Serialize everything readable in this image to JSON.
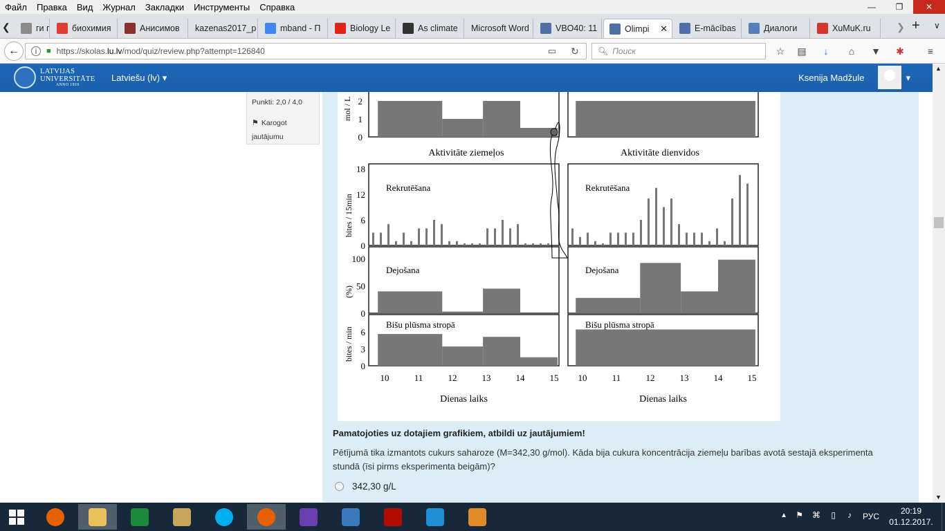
{
  "menubar": {
    "items": [
      "Файл",
      "Правка",
      "Вид",
      "Журнал",
      "Закладки",
      "Инструменты",
      "Справка"
    ]
  },
  "tabs": [
    {
      "label": "ги по Э",
      "icon": "doc-icon",
      "color": "#8a8a8a"
    },
    {
      "label": "биохимия",
      "icon": "yandex-icon",
      "color": "#e03c31"
    },
    {
      "label": "Анисимов",
      "icon": "chart-icon",
      "color": "#8b2f2f"
    },
    {
      "label": "kazenas2017_p",
      "icon": "blank-icon",
      "color": "#ffffff"
    },
    {
      "label": "mband - П",
      "icon": "google-icon",
      "color": "#4285f4"
    },
    {
      "label": "Biology Le",
      "icon": "youtube-icon",
      "color": "#e62117"
    },
    {
      "label": "As climate",
      "icon": "sd-icon",
      "color": "#333333"
    },
    {
      "label": "Microsoft Word",
      "icon": "blank-icon",
      "color": "#ffffff"
    },
    {
      "label": "VBO40: 11",
      "icon": "moodle-icon",
      "color": "#4f6fa8"
    },
    {
      "label": "Olimpi",
      "icon": "moodle-icon",
      "color": "#4f6fa8",
      "active": true
    },
    {
      "label": "E-mācības",
      "icon": "moodle-icon",
      "color": "#4f6fa8"
    },
    {
      "label": "Диалоги",
      "icon": "chat-icon",
      "color": "#5181b8"
    },
    {
      "label": "XuMuK.ru",
      "icon": "xumuk-icon",
      "color": "#d9342b"
    }
  ],
  "nav": {
    "url_prefix": "https://skolas.",
    "url_domain": "lu.lv",
    "url_path": "/mod/quiz/review.php?attempt=126840",
    "search_placeholder": "Поиск"
  },
  "site": {
    "logo_line1": "LATVIJAS",
    "logo_line2": "UNIVERSITĀTE",
    "logo_line3": "ANNO 1919",
    "language": "Latviešu (lv)",
    "user_name": "Ksenija Madžule"
  },
  "question_info": {
    "points": "Punkti: 2,0 / 4,0",
    "flag_label": "Karogot jautājumu"
  },
  "figure": {
    "top_ylabel": "mol / L",
    "top_left_title": "Aktivitāte ziemeļos",
    "top_right_title": "Aktivitāte dienvidos",
    "mid_ylabel": "bites / 15min",
    "recruit_label": "Rekrutēšana",
    "dance_ylabel": "(%)",
    "dance_label": "Dejošana",
    "flow_ylabel": "bites / min",
    "flow_label": "Bišu plūsma stropā",
    "xlabel": "Dienas laiks",
    "x_ticks": [
      "10",
      "11",
      "12",
      "13",
      "14",
      "15"
    ],
    "top_y_ticks": [
      "2",
      "1",
      "0"
    ],
    "recruit_y_ticks": [
      "18",
      "12",
      "6",
      "0"
    ],
    "dance_y_ticks": [
      "100",
      "50",
      "0"
    ],
    "flow_y_ticks": [
      "6",
      "3",
      "0"
    ]
  },
  "chart_data": [
    {
      "type": "bar",
      "title": "Aktivitāte ziemeļos",
      "ylabel": "mol / L",
      "x": [
        10,
        11,
        12,
        13,
        14,
        15
      ],
      "segments": [
        {
          "from": 9.8,
          "to": 11.7,
          "value": 2
        },
        {
          "from": 11.7,
          "to": 12.9,
          "value": 1
        },
        {
          "from": 12.9,
          "to": 14.0,
          "value": 2
        },
        {
          "from": 14.0,
          "to": 15.1,
          "value": 0.5
        }
      ]
    },
    {
      "type": "bar",
      "title": "Aktivitāte dienvidos",
      "ylabel": "mol / L",
      "segments": [
        {
          "from": 9.8,
          "to": 15.1,
          "value": 2
        }
      ]
    },
    {
      "type": "bar",
      "title": "Rekrutēšana (ziemeļi)",
      "ylabel": "bites / 15min",
      "ylim": [
        0,
        18
      ],
      "values": [
        3,
        3,
        5,
        1,
        3,
        1,
        4,
        4,
        6,
        5,
        1,
        1,
        0.5,
        0.5,
        0.5,
        4,
        4,
        6,
        4,
        5,
        0.5,
        0.5,
        0.5,
        0.5
      ]
    },
    {
      "type": "bar",
      "title": "Rekrutēšana (dienvidi)",
      "ylabel": "bites / 15min",
      "ylim": [
        0,
        18
      ],
      "values": [
        4,
        2,
        3,
        1,
        0.5,
        3,
        3,
        3,
        3,
        6,
        11,
        13.5,
        9,
        11,
        5,
        3,
        3,
        3,
        1,
        4,
        1,
        11,
        16.5,
        14.5
      ]
    },
    {
      "type": "bar",
      "title": "Dejošana (ziemeļi)",
      "ylabel": "(%)",
      "ylim": [
        0,
        100
      ],
      "segments": [
        {
          "from": 9.8,
          "to": 11.7,
          "value": 40
        },
        {
          "from": 11.7,
          "to": 12.9,
          "value": 3
        },
        {
          "from": 12.9,
          "to": 14.0,
          "value": 45
        },
        {
          "from": 14.0,
          "to": 15.1,
          "value": 0
        }
      ]
    },
    {
      "type": "bar",
      "title": "Dejošana (dienvidi)",
      "ylabel": "(%)",
      "ylim": [
        0,
        100
      ],
      "segments": [
        {
          "from": 9.8,
          "to": 11.7,
          "value": 28
        },
        {
          "from": 11.7,
          "to": 12.9,
          "value": 92
        },
        {
          "from": 12.9,
          "to": 14.0,
          "value": 40
        },
        {
          "from": 14.0,
          "to": 15.1,
          "value": 98
        }
      ]
    },
    {
      "type": "bar",
      "title": "Bišu plūsma stropā (ziemeļi)",
      "ylabel": "bites / min",
      "ylim": [
        0,
        9
      ],
      "segments": [
        {
          "from": 9.8,
          "to": 11.7,
          "value": 5.6
        },
        {
          "from": 11.7,
          "to": 12.9,
          "value": 3.4
        },
        {
          "from": 12.9,
          "to": 14.0,
          "value": 5.1
        },
        {
          "from": 14.0,
          "to": 15.1,
          "value": 1.5
        }
      ]
    },
    {
      "type": "bar",
      "title": "Bišu plūsma stropā (dienvidi)",
      "ylabel": "bites / min",
      "ylim": [
        0,
        9
      ],
      "segments": [
        {
          "from": 9.8,
          "to": 15.1,
          "value": 6.4
        }
      ]
    }
  ],
  "question": {
    "instruction": "Pamatojoties uz dotajiem grafikiem, atbildi uz jautājumiem!",
    "text": "Pētījumā tika izmantots cukurs saharoze (M=342,30 g/mol). Kāda bija cukura koncentrācija ziemeļu barības avotā sestajā eksperimenta stundā (īsi pirms eksperimenta beigām)?",
    "option1": "342,30 g/L"
  },
  "taskbar": {
    "apps": [
      "firefox-icon",
      "explorer-icon",
      "store-icon",
      "tools-icon",
      "skype-icon",
      "firefox-icon",
      "notes-icon",
      "photos-icon",
      "pdf-icon",
      "word-icon",
      "media-icon"
    ],
    "lang": "РУС",
    "time": "20:19",
    "date": "01.12.2017."
  }
}
